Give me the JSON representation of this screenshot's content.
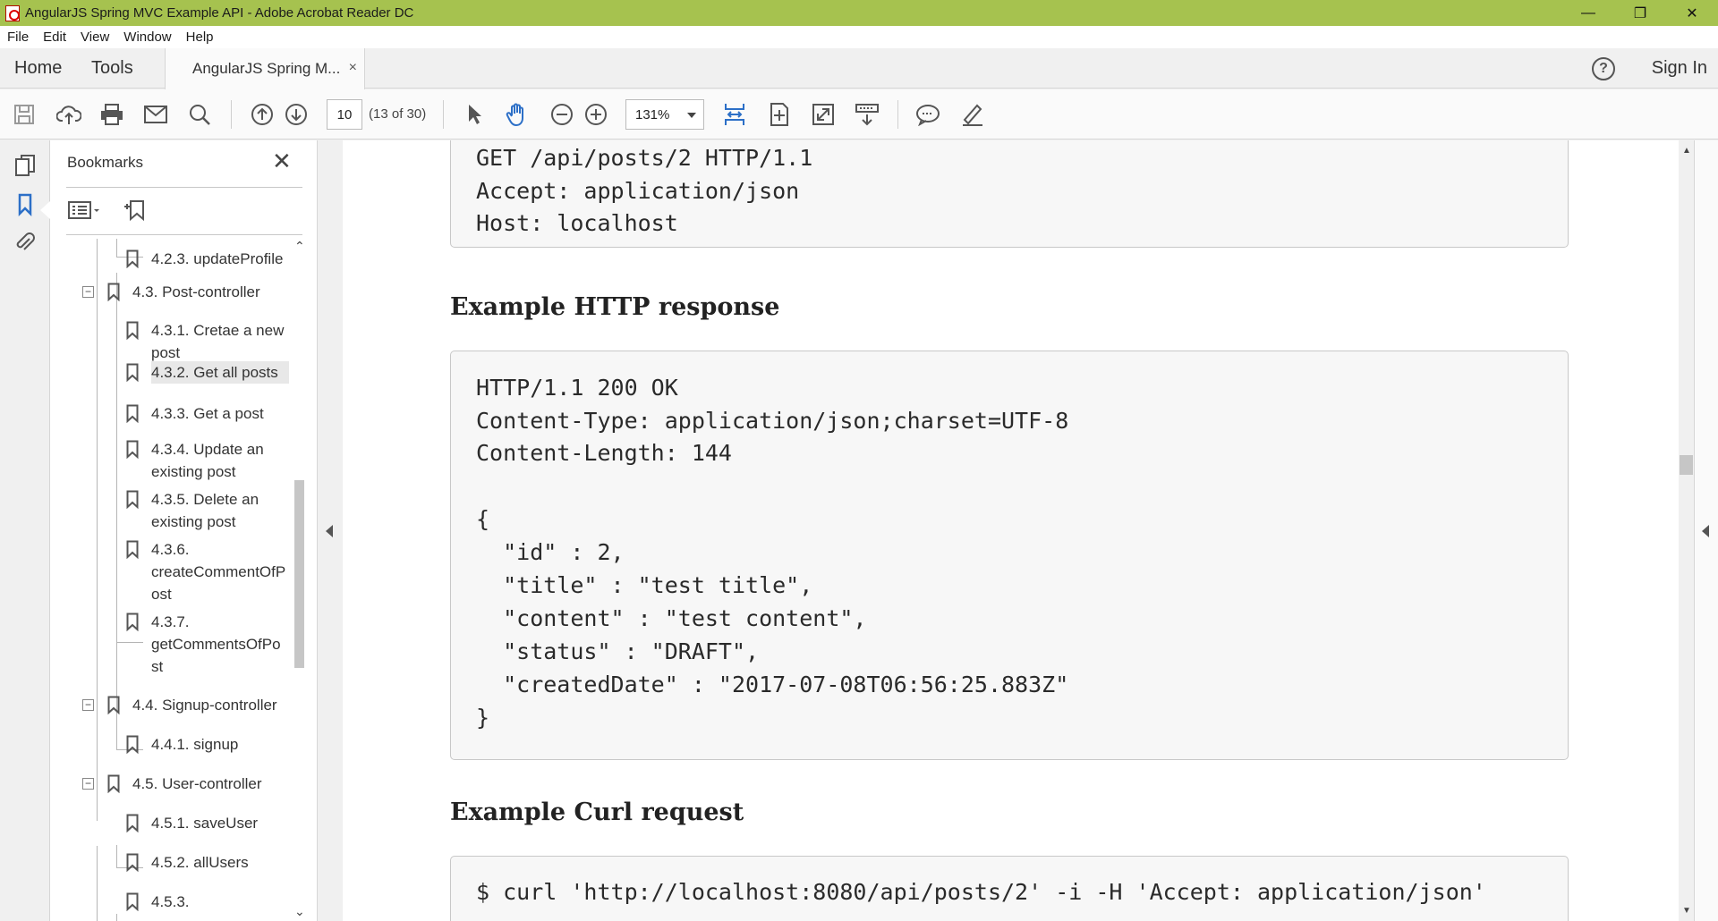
{
  "window": {
    "title": "AngularJS Spring MVC Example API - Adobe Acrobat Reader DC",
    "minimize": "—",
    "restore": "❐",
    "close": "✕"
  },
  "menu": [
    "File",
    "Edit",
    "View",
    "Window",
    "Help"
  ],
  "tabs": {
    "home": "Home",
    "tools": "Tools",
    "document": "AngularJS Spring M...",
    "close": "×",
    "help": "?",
    "sign_in": "Sign In"
  },
  "toolbar": {
    "page_number": "10",
    "page_count": "(13 of 30)",
    "zoom": "131%",
    "accent_color": "#2c6fc7"
  },
  "bookmarks": {
    "title": "Bookmarks",
    "close": "✕",
    "items": [
      "4.2.3. updateProfile",
      "4.3. Post-controller",
      "4.3.1. Cretae a new\npost",
      "4.3.2. Get all posts",
      "4.3.3. Get a post",
      "4.3.4. Update an\nexisting post",
      "4.3.5. Delete an\nexisting post",
      "4.3.6.\ncreateCommentOfP\nost",
      "4.3.7.\ngetCommentsOfPo\nst",
      "4.4. Signup-controller",
      "4.4.1. signup",
      "4.5. User-controller",
      "4.5.1. saveUser",
      "4.5.2. allUsers",
      "4.5.3."
    ],
    "toggle": "−",
    "scroll_up": "⌃",
    "scroll_down": "⌄"
  },
  "document": {
    "request_lines": [
      "GET /api/posts/2 HTTP/1.1",
      "Accept: application/json",
      "Host: localhost"
    ],
    "response_heading": "Example HTTP response",
    "response_lines": [
      "HTTP/1.1 200 OK",
      "Content-Type: application/json;charset=UTF-8",
      "Content-Length: 144",
      "",
      "{",
      "  \"id\" : 2,",
      "  \"title\" : \"test title\",",
      "  \"content\" : \"test content\",",
      "  \"status\" : \"DRAFT\",",
      "  \"createdDate\" : \"2017-07-08T06:56:25.883Z\"",
      "}"
    ],
    "curl_heading": "Example Curl request",
    "curl_lines": [
      "$ curl 'http://localhost:8080/api/posts/2' -i -H 'Accept: application/json'"
    ]
  },
  "scroll": {
    "up": "▲",
    "down": "▼"
  }
}
